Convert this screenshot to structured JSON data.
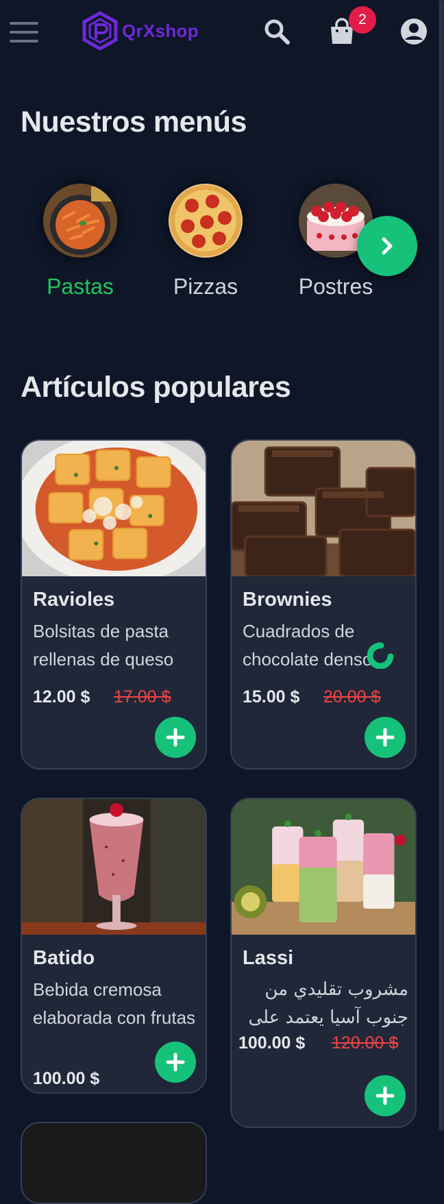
{
  "header": {
    "logo_text": "QrXshop",
    "cart_count": "2",
    "accent_color": "#6d28d9"
  },
  "menus": {
    "title": "Nuestros menús",
    "items": [
      {
        "label": "Pastas",
        "active": true
      },
      {
        "label": "Pizzas",
        "active": false
      },
      {
        "label": "Postres",
        "active": false
      }
    ],
    "next_icon": "chevron-right-icon"
  },
  "popular": {
    "title": "Artículos populares",
    "items": [
      {
        "name": "Ravioles",
        "description": "Bolsitas de pasta rellenas de queso",
        "price": "12.00 $",
        "old_price": "17.00 $"
      },
      {
        "name": "Brownies",
        "description": "Cuadrados de chocolate denso",
        "price": "15.00 $",
        "old_price": "20.00 $"
      },
      {
        "name": "Batido",
        "description": "Bebida cremosa elaborada con frutas",
        "price": "100.00 $",
        "old_price": ""
      },
      {
        "name": "Lassi",
        "description": "مشروب تقليدي من جنوب آسيا يعتمد على",
        "price": "100.00 $",
        "old_price": "120.00 $"
      }
    ]
  },
  "colors": {
    "background": "#0e1628",
    "card": "#1f2738",
    "green": "#16c27a",
    "red": "#ef4444",
    "badge": "#e11d48"
  }
}
